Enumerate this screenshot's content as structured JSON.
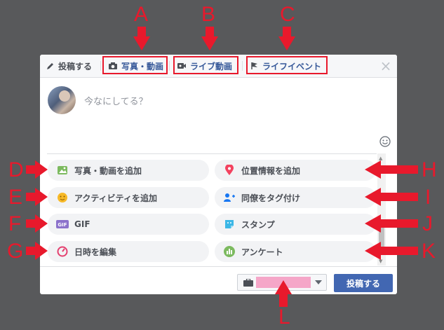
{
  "tabs": [
    {
      "label": "投稿する",
      "icon": "pencil-icon"
    },
    {
      "label": "写真・動画",
      "icon": "camera-icon"
    },
    {
      "label": "ライブ動画",
      "icon": "video-camera-icon"
    },
    {
      "label": "ライフイベント",
      "icon": "flag-icon"
    }
  ],
  "close_label": "×",
  "composer": {
    "placeholder": "今なにしてる？"
  },
  "options": [
    {
      "label": "写真・動画を追加",
      "icon": "photo-icon",
      "color": "#7cba5f"
    },
    {
      "label": "位置情報を追加",
      "icon": "location-pin-icon",
      "color": "#f3425f"
    },
    {
      "label": "アクティビティを追加",
      "icon": "smiley-icon",
      "color": "#f7b928"
    },
    {
      "label": "同僚をタグ付け",
      "icon": "tag-people-icon",
      "color": "#1877f2"
    },
    {
      "label": "GIF",
      "icon": "gif-icon",
      "color": "#8c72cb"
    },
    {
      "label": "スタンプ",
      "icon": "sticker-icon",
      "color": "#3cb7e6"
    },
    {
      "label": "日時を編集",
      "icon": "clock-icon",
      "color": "#e4406f"
    },
    {
      "label": "アンケート",
      "icon": "poll-icon",
      "color": "#7cba5f"
    }
  ],
  "gif_badge": "GIF",
  "footer": {
    "post_label": "投稿する"
  },
  "annotations": [
    "A",
    "B",
    "C",
    "D",
    "E",
    "F",
    "G",
    "H",
    "I",
    "J",
    "K",
    "L"
  ],
  "colors": {
    "annotation": "#e8192c",
    "accent": "#4267b2"
  }
}
